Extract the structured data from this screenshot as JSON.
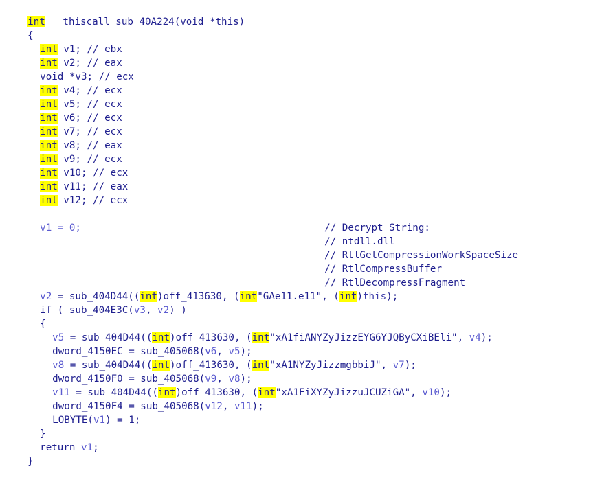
{
  "code": {
    "header": {
      "return_type": "int",
      "signature": " __thiscall sub_40A224(void *this)"
    },
    "open_brace": "{",
    "close_brace": "}",
    "decls": [
      {
        "type": "int",
        "name": " v1;",
        "comment": " // ebx"
      },
      {
        "type": "int",
        "name": " v2;",
        "comment": " // eax"
      },
      {
        "type": "void",
        "name": " *v3;",
        "comment": " // ecx"
      },
      {
        "type": "int",
        "name": " v4;",
        "comment": " // ecx"
      },
      {
        "type": "int",
        "name": " v5;",
        "comment": " // ecx"
      },
      {
        "type": "int",
        "name": " v6;",
        "comment": " // ecx"
      },
      {
        "type": "int",
        "name": " v7;",
        "comment": " // ecx"
      },
      {
        "type": "int",
        "name": " v8;",
        "comment": " // eax"
      },
      {
        "type": "int",
        "name": " v9;",
        "comment": " // ecx"
      },
      {
        "type": "int",
        "name": " v10;",
        "comment": " // ecx"
      },
      {
        "type": "int",
        "name": " v11;",
        "comment": " // eax"
      },
      {
        "type": "int",
        "name": " v12;",
        "comment": " // ecx"
      }
    ],
    "assign_v1": {
      "text": "v1 = 0;",
      "comments": [
        "// Decrypt String:",
        "// ntdll.dll",
        "// RtlGetCompressionWorkSpaceSize",
        "// RtlCompressBuffer",
        "// RtlDecompressFragment"
      ]
    },
    "line_v2": {
      "lhs": "v2",
      "a": " = sub_404D44((",
      "t1": "int",
      "b": ")off_413630, (",
      "t2": "int",
      "str": "\"GAe11.e11\"",
      "c": ", (",
      "t3": "int",
      "d": ")",
      "this_word": "this",
      "e": ");"
    },
    "if_line": {
      "a": "if ( sub_404E3C(",
      "v3": "v3",
      "b": ", ",
      "v2": "v2",
      "c": ") )"
    },
    "inner_open": "{",
    "inner_close": "}",
    "calls": [
      {
        "lhs": "v5",
        "a": " = sub_404D44((",
        "t1": "int",
        "b": ")off_413630, (",
        "t2": "int",
        "str": "\"xA1fiANYZyJizzEYG6YJQByCXiBEli\"",
        "c": ", ",
        "arg": "v4",
        "d": ");"
      },
      {
        "lhs": "v8",
        "a": " = sub_404D44((",
        "t1": "int",
        "b": ")off_413630, (",
        "t2": "int",
        "str": "\"xA1NYZyJizzmgbbiJ\"",
        "c": ", ",
        "arg": "v7",
        "d": ");"
      },
      {
        "lhs": "v11",
        "a": " = sub_404D44((",
        "t1": "int",
        "b": ")off_413630, (",
        "t2": "int",
        "str": "\"xA1FiXYZyJizzuJCUZiGA\"",
        "c": ", ",
        "arg": "v10",
        "d": ");"
      }
    ],
    "dwords": [
      {
        "lhs": "dword_4150EC",
        "a": " = sub_405068(",
        "x": "v6",
        "b": ", ",
        "y": "v5",
        "c": ");"
      },
      {
        "lhs": "dword_4150F0",
        "a": " = sub_405068(",
        "x": "v9",
        "b": ", ",
        "y": "v8",
        "c": ");"
      },
      {
        "lhs": "dword_4150F4",
        "a": " = sub_405068(",
        "x": "v12",
        "b": ", ",
        "y": "v11",
        "c": ");"
      }
    ],
    "lobyte": {
      "a": "LOBYTE(",
      "v": "v1",
      "b": ") = 1;"
    },
    "return_line": {
      "a": "return ",
      "v": "v1",
      "b": ";"
    }
  }
}
